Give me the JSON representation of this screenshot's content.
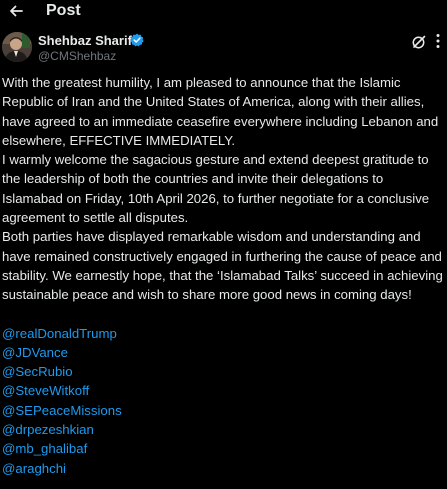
{
  "header": {
    "back_icon": "arrow-left-icon",
    "title": "Post"
  },
  "author": {
    "name": "Shehbaz Sharif",
    "handle": "@CMShehbaz",
    "verified_icon": "verified-badge-icon",
    "verified_color": "#1d9bf0",
    "grok_icon": "grok-icon",
    "more_icon": "more-vertical-icon"
  },
  "post": {
    "paragraphs": [
      "With the greatest humility, I am pleased to announce that the Islamic Republic of Iran and the United States of America, along with their allies, have agreed to an immediate ceasefire everywhere including Lebanon and elsewhere, EFFECTIVE IMMEDIATELY.",
      "I warmly welcome the sagacious gesture and extend deepest gratitude to the leadership of both the countries and invite their delegations to Islamabad on Friday, 10th April 2026, to further negotiate for a conclusive agreement to settle all disputes.",
      "Both parties have displayed remarkable wisdom and understanding and have remained constructively engaged in furthering the cause of peace and stability. We earnestly hope, that the ‘Islamabad Talks’ succeed in achieving sustainable peace and wish to share more good news in coming days!"
    ],
    "mentions": [
      "@realDonaldTrump",
      "@JDVance",
      "@SecRubio",
      "@SteveWitkoff",
      "@SEPeaceMissions",
      "@drpezeshkian",
      "@mb_ghalibaf",
      "@araghchi"
    ]
  },
  "colors": {
    "background": "#000000",
    "text": "#e7e9ea",
    "muted": "#71767b",
    "link": "#1d9bf0"
  }
}
